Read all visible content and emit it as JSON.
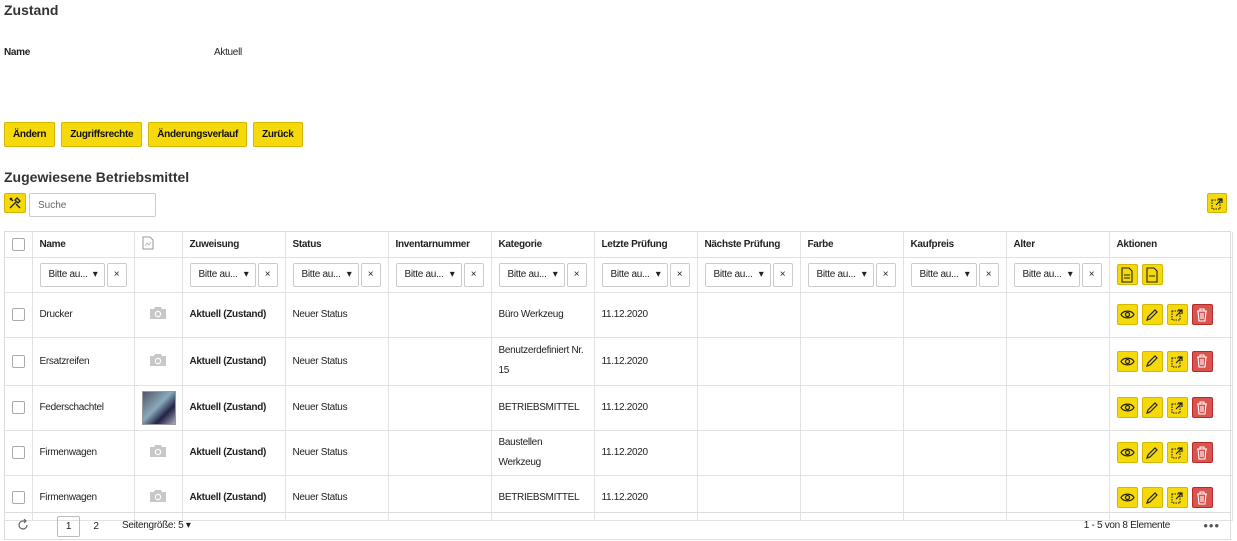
{
  "page": {
    "title": "Zustand"
  },
  "info": {
    "label": "Name",
    "value": "Aktuell"
  },
  "buttons": {
    "edit": "Ändern",
    "permissions": "Zugriffsrechte",
    "history": "Änderungsverlauf",
    "back": "Zurück"
  },
  "section": {
    "title": "Zugewiesene Betriebsmittel"
  },
  "search": {
    "placeholder": "Suche"
  },
  "columns": [
    "Name",
    "Zuweisung",
    "Status",
    "Inventarnummer",
    "Kategorie",
    "Letzte Prüfung",
    "Nächste Prüfung",
    "Farbe",
    "Kaufpreis",
    "Alter",
    "Aktionen"
  ],
  "filter": {
    "placeholder": "Bitte au...",
    "clear": "×"
  },
  "rows": [
    {
      "name": "Drucker",
      "image": "camera-placeholder",
      "zuweisung": "Aktuell (Zustand)",
      "status": "Neuer Status",
      "inventarnummer": "",
      "kategorie": "Büro Werkzeug",
      "letzte_pruefung": "11.12.2020",
      "naechste_pruefung": "",
      "farbe": "",
      "kaufpreis": "",
      "alter": ""
    },
    {
      "name": "Ersatzreifen",
      "image": "camera-placeholder",
      "zuweisung": "Aktuell (Zustand)",
      "status": "Neuer Status",
      "inventarnummer": "",
      "kategorie": "Benutzerdefiniert Nr. 15",
      "letzte_pruefung": "11.12.2020",
      "naechste_pruefung": "",
      "farbe": "",
      "kaufpreis": "",
      "alter": ""
    },
    {
      "name": "Federschachtel",
      "image": "photo",
      "zuweisung": "Aktuell (Zustand)",
      "status": "Neuer Status",
      "inventarnummer": "",
      "kategorie": "BETRIEBSMITTEL",
      "letzte_pruefung": "11.12.2020",
      "naechste_pruefung": "",
      "farbe": "",
      "kaufpreis": "",
      "alter": ""
    },
    {
      "name": "Firmenwagen",
      "image": "camera-placeholder",
      "zuweisung": "Aktuell (Zustand)",
      "status": "Neuer Status",
      "inventarnummer": "",
      "kategorie": "Baustellen Werkzeug",
      "letzte_pruefung": "11.12.2020",
      "naechste_pruefung": "",
      "farbe": "",
      "kaufpreis": "",
      "alter": ""
    },
    {
      "name": "Firmenwagen",
      "image": "camera-placeholder",
      "zuweisung": "Aktuell (Zustand)",
      "status": "Neuer Status",
      "inventarnummer": "",
      "kategorie": "BETRIEBSMITTEL",
      "letzte_pruefung": "11.12.2020",
      "naechste_pruefung": "",
      "farbe": "",
      "kaufpreis": "",
      "alter": ""
    }
  ],
  "pager": {
    "page1": "1",
    "page2": "2",
    "page_size": "Seitengröße: 5",
    "count": "1 - 5 von 8 Elemente",
    "more": "•••"
  },
  "colors": {
    "accent": "#f5d90a",
    "danger": "#d9534f"
  },
  "icons": {
    "tools": "tools-icon",
    "export": "export-icon",
    "view": "eye-icon",
    "edit": "pencil-icon",
    "delete": "trash-icon",
    "camera": "camera-icon"
  }
}
